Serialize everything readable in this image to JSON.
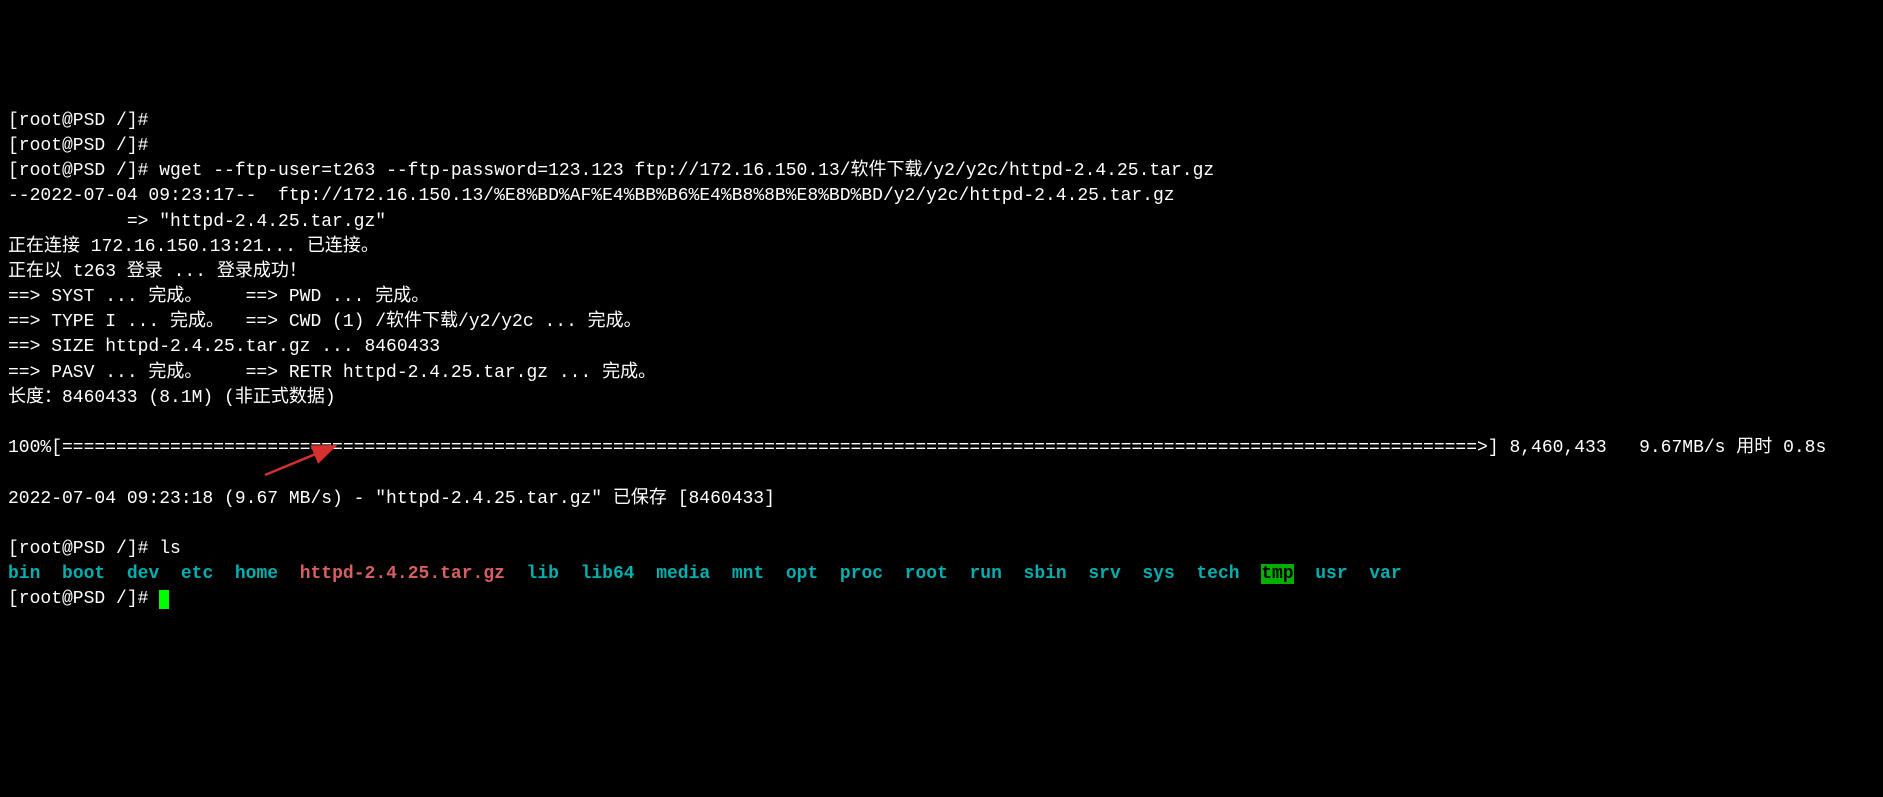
{
  "prompts": {
    "p1": "[root@PSD /]#",
    "p2": "[root@PSD /]#",
    "p3": "[root@PSD /]# ",
    "p4": "[root@PSD /]# ",
    "p5": "[root@PSD /]# "
  },
  "commands": {
    "wget": "wget --ftp-user=t263 --ftp-password=123.123 ftp://172.16.150.13/软件下载/y2/y2c/httpd-2.4.25.tar.gz",
    "ls": "ls"
  },
  "wget_output": {
    "l1": "--2022-07-04 09:23:17--  ftp://172.16.150.13/%E8%BD%AF%E4%BB%B6%E4%B8%8B%E8%BD%BD/y2/y2c/httpd-2.4.25.tar.gz",
    "l2": "           => \"httpd-2.4.25.tar.gz\"",
    "l3": "正在连接 172.16.150.13:21... 已连接。",
    "l4": "正在以 t263 登录 ... 登录成功！",
    "l5": "==> SYST ... 完成。    ==> PWD ... 完成。",
    "l6": "==> TYPE I ... 完成。  ==> CWD (1) /软件下载/y2/y2c ... 完成。",
    "l7": "==> SIZE httpd-2.4.25.tar.gz ... 8460433",
    "l8": "==> PASV ... 完成。    ==> RETR httpd-2.4.25.tar.gz ... 完成。",
    "l9": "长度：8460433 (8.1M) (非正式数据)",
    "progress": "100%[===================================================================================================================================>] 8,460,433   9.67MB/s 用时 0.8s",
    "saved": "2022-07-04 09:23:18 (9.67 MB/s) - \"httpd-2.4.25.tar.gz\" 已保存 [8460433]"
  },
  "ls": {
    "bin": "bin",
    "boot": "boot",
    "dev": "dev",
    "etc": "etc",
    "home": "home",
    "httpd": "httpd-2.4.25.tar.gz",
    "lib": "lib",
    "lib64": "lib64",
    "media": "media",
    "mnt": "mnt",
    "opt": "opt",
    "proc": "proc",
    "root": "root",
    "run": "run",
    "sbin": "sbin",
    "srv": "srv",
    "sys": "sys",
    "tech": "tech",
    "tmp": "tmp",
    "usr": "usr",
    "var": "var"
  }
}
